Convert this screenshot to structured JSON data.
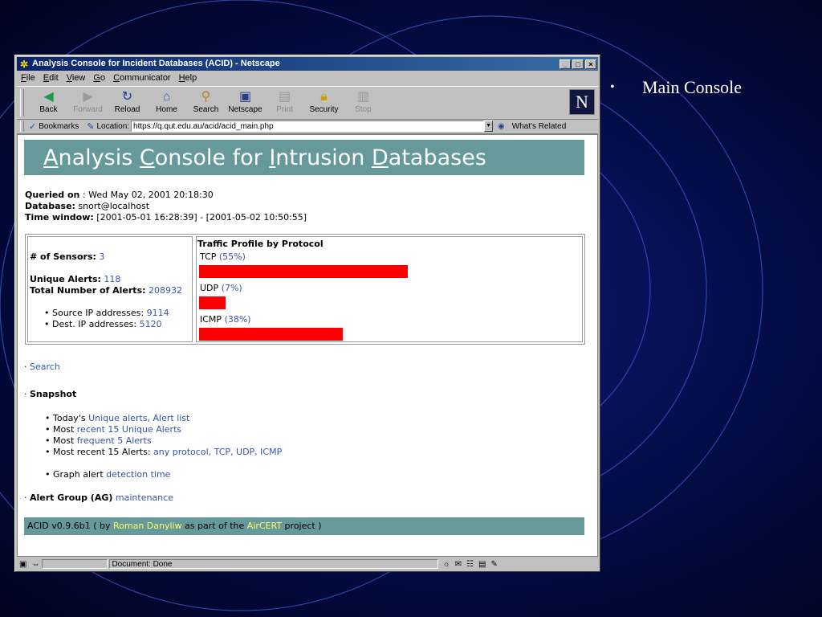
{
  "slide": {
    "bullet": "Main Console"
  },
  "window": {
    "title": "Analysis Console for Incident Databases (ACID) - Netscape",
    "controls": {
      "minimize": "_",
      "maximize": "□",
      "close": "×"
    }
  },
  "menu": [
    "File",
    "Edit",
    "View",
    "Go",
    "Communicator",
    "Help"
  ],
  "toolbar": {
    "buttons": [
      {
        "label": "Back",
        "icon": "back-arrow-icon",
        "enabled": true
      },
      {
        "label": "Forward",
        "icon": "forward-arrow-icon",
        "enabled": false
      },
      {
        "label": "Reload",
        "icon": "reload-icon",
        "enabled": true
      },
      {
        "label": "Home",
        "icon": "home-icon",
        "enabled": true
      },
      {
        "label": "Search",
        "icon": "search-icon",
        "enabled": true
      },
      {
        "label": "Netscape",
        "icon": "netscape-icon",
        "enabled": true
      },
      {
        "label": "Print",
        "icon": "print-icon",
        "enabled": false
      },
      {
        "label": "Security",
        "icon": "lock-icon",
        "enabled": true
      },
      {
        "label": "Stop",
        "icon": "stop-icon",
        "enabled": false
      }
    ],
    "logo": "N"
  },
  "location": {
    "bookmarks": "Bookmarks",
    "label": "Location:",
    "url": "https://q.qut.edu.au/acid/acid_main.php",
    "related": "What's Related"
  },
  "page": {
    "banner_title": {
      "w1a": "A",
      "w1b": "nalysis ",
      "w2a": "C",
      "w2b": "onsole for ",
      "w3a": "I",
      "w3b": "ntrusion ",
      "w4a": "D",
      "w4b": "atabases"
    },
    "meta": {
      "queried_label": "Queried on",
      "queried_value": " : Wed May 02, 2001 20:18:30",
      "database_label": "Database:",
      "database_value": " snort@localhost",
      "time_label": "Time window:",
      "time_value": " [2001-05-01 16:28:39] - [2001-05-02 10:50:55]"
    },
    "stats": {
      "sensors_label": "# of Sensors:",
      "sensors_value": "3",
      "unique_label": "Unique Alerts:",
      "unique_value": "118",
      "total_label": "Total Number of Alerts:",
      "total_value": "208932",
      "src_label": "Source IP addresses:",
      "src_value": "9114",
      "dst_label": "Dest. IP addresses:",
      "dst_value": "5120"
    },
    "traffic": {
      "title": "Traffic Profile by Protocol",
      "protocols": [
        {
          "name": "TCP",
          "pct": "(55%)",
          "value": 55
        },
        {
          "name": "UDP",
          "pct": "(7%)",
          "value": 7
        },
        {
          "name": "ICMP",
          "pct": "(38%)",
          "value": 38
        }
      ],
      "bar_color": "#ff0000"
    },
    "search_link": "Search",
    "snapshot_title": "Snapshot",
    "snapshot": {
      "today_prefix": "Today's ",
      "today_link1": "Unique alerts",
      "today_sep": ", ",
      "today_link2": "Alert list",
      "most1_prefix": "Most ",
      "most1_link": "recent 15 Unique Alerts",
      "most2_prefix": "Most ",
      "most2_link": "frequent 5 Alerts",
      "recent_prefix": "Most recent 15 Alerts: ",
      "recent_links": [
        "any protocol",
        "TCP",
        "UDP",
        "ICMP"
      ],
      "graph_prefix": "Graph alert ",
      "graph_link": "detection time"
    },
    "ag_label": "Alert Group (AG)",
    "ag_link": "maintenance",
    "footer": {
      "prefix": "ACID v0.9.6b1 ( by ",
      "author": "Roman Danyliw",
      "middle": " as part of the ",
      "project": "AirCERT",
      "suffix": " project )"
    },
    "accent_color": "#669999",
    "link_color": "#3355aa"
  },
  "status": {
    "text": "Document: Done"
  }
}
